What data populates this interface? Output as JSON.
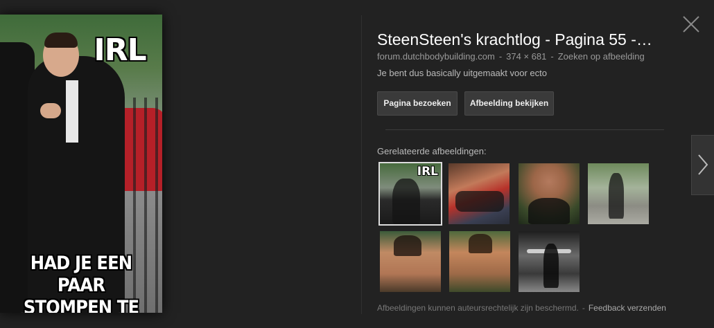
{
  "main_image": {
    "top_text": "IRL",
    "bottom_text": "HAD JE EEN PAAR STOMPEN TE PAKKEN"
  },
  "details": {
    "title": "SteenSteen's krachtlog - Pagina 55 -…",
    "domain": "forum.dutchbodybuilding.com",
    "dimensions": "374 × 681",
    "search_by_image": "Zoeken op afbeelding",
    "description": "Je bent dus basically uitgemaakt voor ecto",
    "visit_button": "Pagina bezoeken",
    "view_button": "Afbeelding bekijken"
  },
  "related": {
    "title": "Gerelateerde afbeeldingen:",
    "thumbnails": [
      {
        "label": "IRL",
        "selected": true
      },
      {
        "label": "",
        "selected": false
      },
      {
        "label": "",
        "selected": false
      },
      {
        "label": "",
        "selected": false
      },
      {
        "label": "",
        "selected": false
      },
      {
        "label": "",
        "selected": false
      },
      {
        "label": "",
        "selected": false
      }
    ]
  },
  "footer": {
    "copyright": "Afbeeldingen kunnen auteursrechtelijk zijn beschermd.",
    "separator": "-",
    "feedback": "Feedback verzenden"
  },
  "icons": {
    "close": "close-icon",
    "next": "chevron-right-icon"
  },
  "colors": {
    "background": "#222222",
    "title": "#ffffff",
    "meta": "#999999",
    "button_bg": "#3a3a3a"
  }
}
